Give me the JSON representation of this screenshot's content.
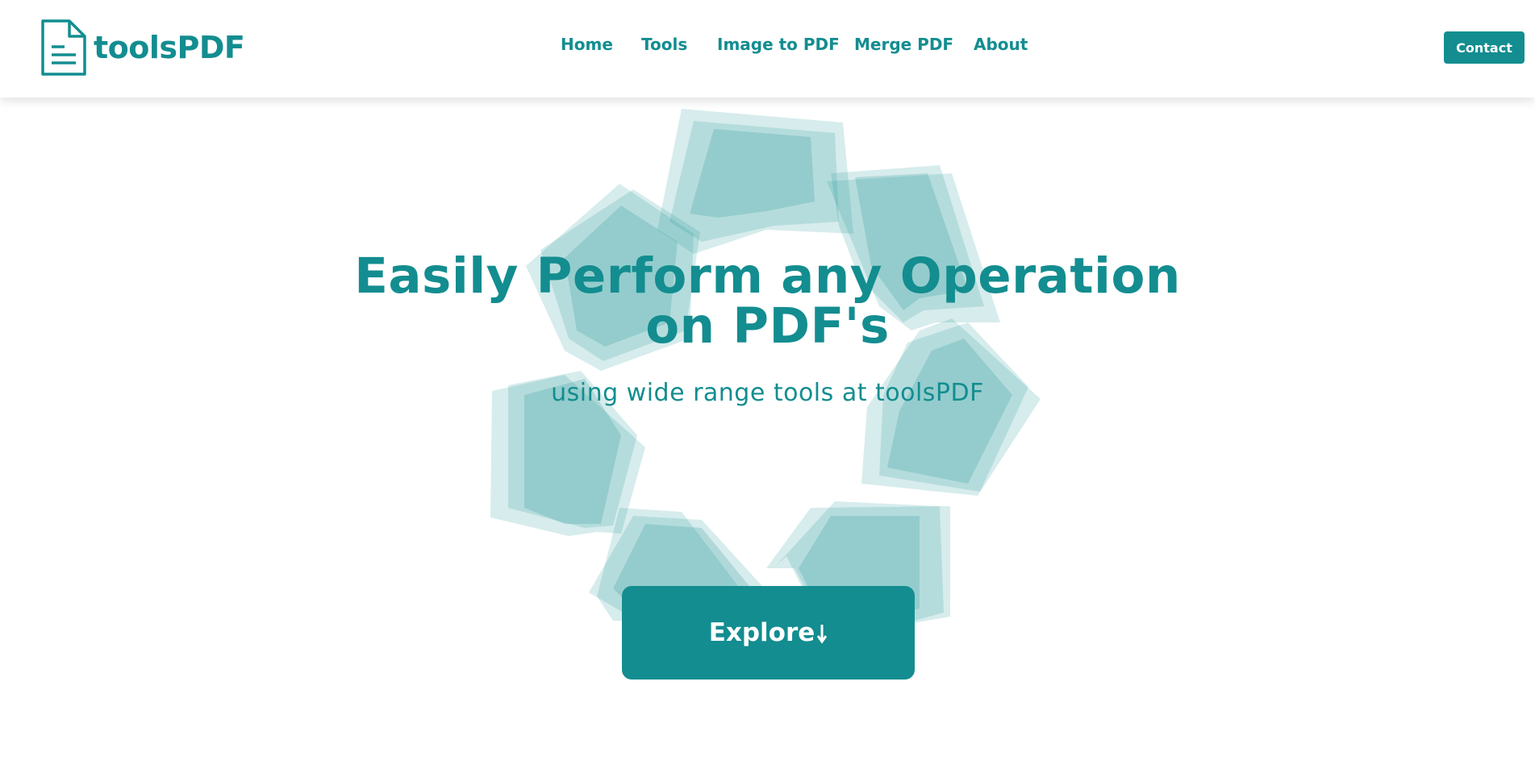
{
  "brand": {
    "name": "toolsPDF",
    "icon": "document-icon",
    "color": "#138d90"
  },
  "nav": {
    "items": [
      {
        "label": "Home"
      },
      {
        "label": "Tools"
      },
      {
        "label": "Image to PDF"
      },
      {
        "label": "Merge PDF"
      },
      {
        "label": "About"
      }
    ],
    "contact_label": "Contact"
  },
  "hero": {
    "title_line1": "Easily Perform any Operation",
    "title_line2": "on PDF's",
    "subtitle": "using wide range tools at toolsPDF",
    "explore_label": "Explore",
    "explore_icon": "arrow-down-icon",
    "background_art": "rotating-pages-illustration"
  },
  "colors": {
    "accent": "#138d90",
    "art_light": "#d6ecec",
    "art_dark": "#9dd1d3",
    "background": "#ffffff"
  }
}
